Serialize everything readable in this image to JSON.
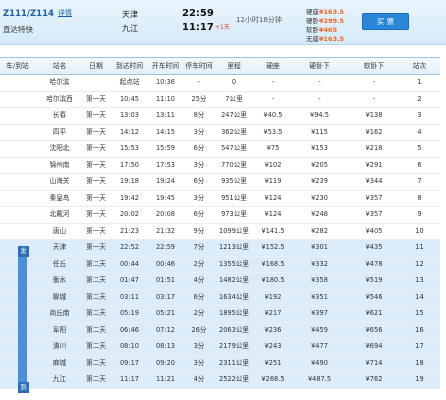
{
  "header": {
    "train_no": "Z111/Z114",
    "detail_link": "详情",
    "train_type": "直达特快",
    "from_station": "天津",
    "to_station": "九江",
    "dep_time": "22:59",
    "arr_time": "11:17",
    "arr_plus": "+1天",
    "duration": "12小时18分钟",
    "prices": [
      {
        "label": "硬座",
        "value": "¥163.5"
      },
      {
        "label": "硬卧",
        "value": "¥299.5"
      },
      {
        "label": "软卧",
        "value": "¥465"
      },
      {
        "label": "无座",
        "value": "¥163.5"
      }
    ],
    "buy_label": "买 票"
  },
  "table": {
    "columns": [
      "车/到站",
      "站名",
      "日期",
      "到达时间",
      "开车时间",
      "停车时间",
      "里程",
      "硬座",
      "硬卧下",
      "软卧下",
      "站次"
    ],
    "rows": [
      [
        "",
        "哈尔滨",
        "",
        "起点站",
        "10:36",
        "-",
        "0",
        "-",
        "-",
        "-",
        "1"
      ],
      [
        "",
        "哈尔滨西",
        "第一天",
        "10:45",
        "11:10",
        "25分",
        "7公里",
        "-",
        "-",
        "-",
        "2"
      ],
      [
        "",
        "长春",
        "第一天",
        "13:03",
        "13:11",
        "8分",
        "247公里",
        "¥40.5",
        "¥94.5",
        "¥138",
        "3"
      ],
      [
        "",
        "四平",
        "第一天",
        "14:12",
        "14:15",
        "3分",
        "362公里",
        "¥53.5",
        "¥115",
        "¥162",
        "4"
      ],
      [
        "",
        "沈阳北",
        "第一天",
        "15:53",
        "15:59",
        "6分",
        "547公里",
        "¥75",
        "¥153",
        "¥218",
        "5"
      ],
      [
        "",
        "锦州南",
        "第一天",
        "17:50",
        "17:53",
        "3分",
        "770公里",
        "¥102",
        "¥205",
        "¥291",
        "6"
      ],
      [
        "",
        "山海关",
        "第一天",
        "19:18",
        "19:24",
        "6分",
        "935公里",
        "¥119",
        "¥239",
        "¥344",
        "7"
      ],
      [
        "",
        "秦皇岛",
        "第一天",
        "19:42",
        "19:45",
        "3分",
        "951公里",
        "¥124",
        "¥230",
        "¥357",
        "8"
      ],
      [
        "",
        "北戴河",
        "第一天",
        "20:02",
        "20:08",
        "6分",
        "973公里",
        "¥124",
        "¥248",
        "¥357",
        "9"
      ],
      [
        "",
        "唐山",
        "第一天",
        "21:23",
        "21:32",
        "9分",
        "1099公里",
        "¥141.5",
        "¥282",
        "¥405",
        "10"
      ],
      [
        "",
        "天津",
        "第一天",
        "22:52",
        "22:59",
        "7分",
        "1213公里",
        "¥152.5",
        "¥301",
        "¥435",
        "11"
      ],
      [
        "",
        "任丘",
        "第二天",
        "00:44",
        "00:46",
        "2分",
        "1355公里",
        "¥168.5",
        "¥332",
        "¥478",
        "12"
      ],
      [
        "",
        "衡水",
        "第二天",
        "01:47",
        "01:51",
        "4分",
        "1482公里",
        "¥180.5",
        "¥358",
        "¥519",
        "13"
      ],
      [
        "",
        "聊城",
        "第二天",
        "03:11",
        "03:17",
        "6分",
        "1634公里",
        "¥192",
        "¥351",
        "¥546",
        "14"
      ],
      [
        "",
        "商丘南",
        "第二天",
        "05:19",
        "05:21",
        "2分",
        "1895公里",
        "¥217",
        "¥397",
        "¥621",
        "15"
      ],
      [
        "",
        "阜阳",
        "第二天",
        "06:46",
        "07:12",
        "26分",
        "2063公里",
        "¥236",
        "¥459",
        "¥656",
        "16"
      ],
      [
        "",
        "潢川",
        "第二天",
        "08:10",
        "08:13",
        "3分",
        "2179公里",
        "¥243",
        "¥477",
        "¥694",
        "17"
      ],
      [
        "",
        "麻城",
        "第二天",
        "09:17",
        "09:20",
        "3分",
        "2311公里",
        "¥251",
        "¥490",
        "¥714",
        "18"
      ],
      [
        "",
        "九江",
        "第二天",
        "11:17",
        "11:21",
        "4分",
        "2522公里",
        "¥268.5",
        "¥487.5",
        "¥762",
        "19"
      ]
    ]
  },
  "range_markers": {
    "start": "发",
    "end": "到"
  },
  "colors": {
    "accent": "#2a86d9",
    "price": "#f26522",
    "highlight_row": "#dcecf9"
  }
}
